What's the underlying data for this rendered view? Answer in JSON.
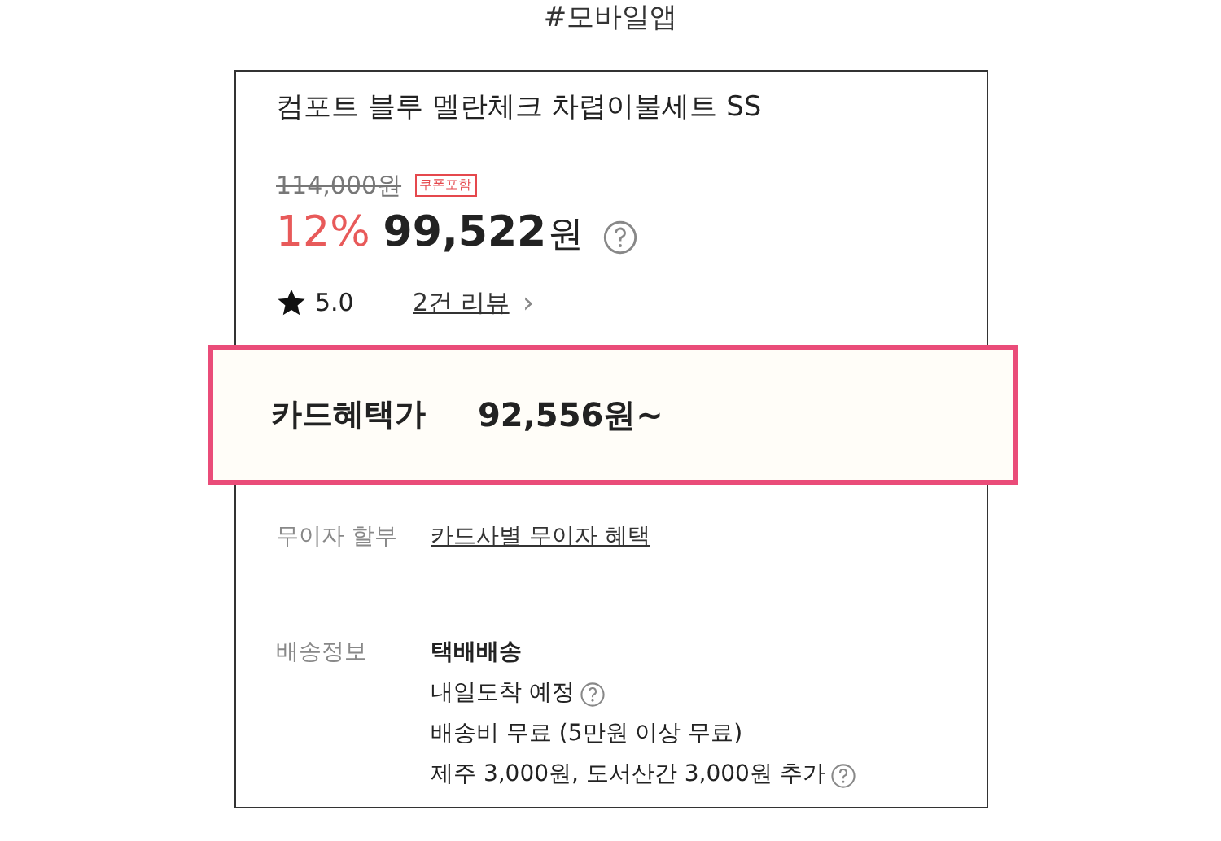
{
  "header": {
    "title": "#모바일앱"
  },
  "product": {
    "name": "컴포트 블루 멜란체크 차렵이불세트 SS",
    "original_price": "114,000원",
    "coupon_badge": "쿠폰포함",
    "discount": "12%",
    "price": "99,522",
    "currency": "원",
    "rating": "5.0",
    "review_link": "2건 리뷰",
    "review_arrow": "›"
  },
  "card_benefit": {
    "label": "카드혜택가",
    "price": "92,556원~",
    "highlighted": true
  },
  "installment": {
    "label": "무이자 할부",
    "link": "카드사별 무이자 혜택"
  },
  "delivery": {
    "label": "배송정보",
    "lines": [
      {
        "text": "택배배송",
        "bold": true,
        "help": false
      },
      {
        "text": "내일도착 예정",
        "bold": false,
        "help": true
      },
      {
        "text": "배송비 무료 (5만원 이상 무료)",
        "bold": false,
        "help": false
      },
      {
        "text": "제주 3,000원, 도서산간 3,000원 추가",
        "bold": false,
        "help": true
      }
    ]
  }
}
